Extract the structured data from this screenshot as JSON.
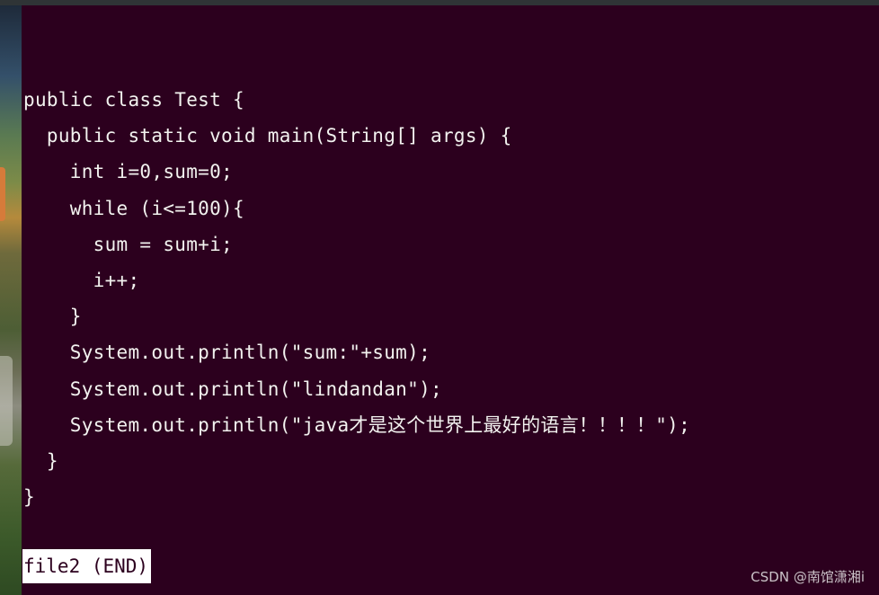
{
  "terminal": {
    "code_lines": [
      "public class Test {",
      "  public static void main(String[] args) {",
      "    int i=0,sum=0;",
      "    while (i<=100){",
      "      sum = sum+i;",
      "      i++;",
      "    }",
      "    System.out.println(\"sum:\"+sum);",
      "    System.out.println(\"lindandan\");",
      "    System.out.println(\"java才是这个世界上最好的语言！！！！\");",
      "  }",
      "}"
    ],
    "status": "file2 (END)"
  },
  "watermark": "CSDN @南馆潇湘i",
  "colors": {
    "background": "#2c001e",
    "text": "#f2f2ef",
    "status_bg": "#ffffff"
  }
}
